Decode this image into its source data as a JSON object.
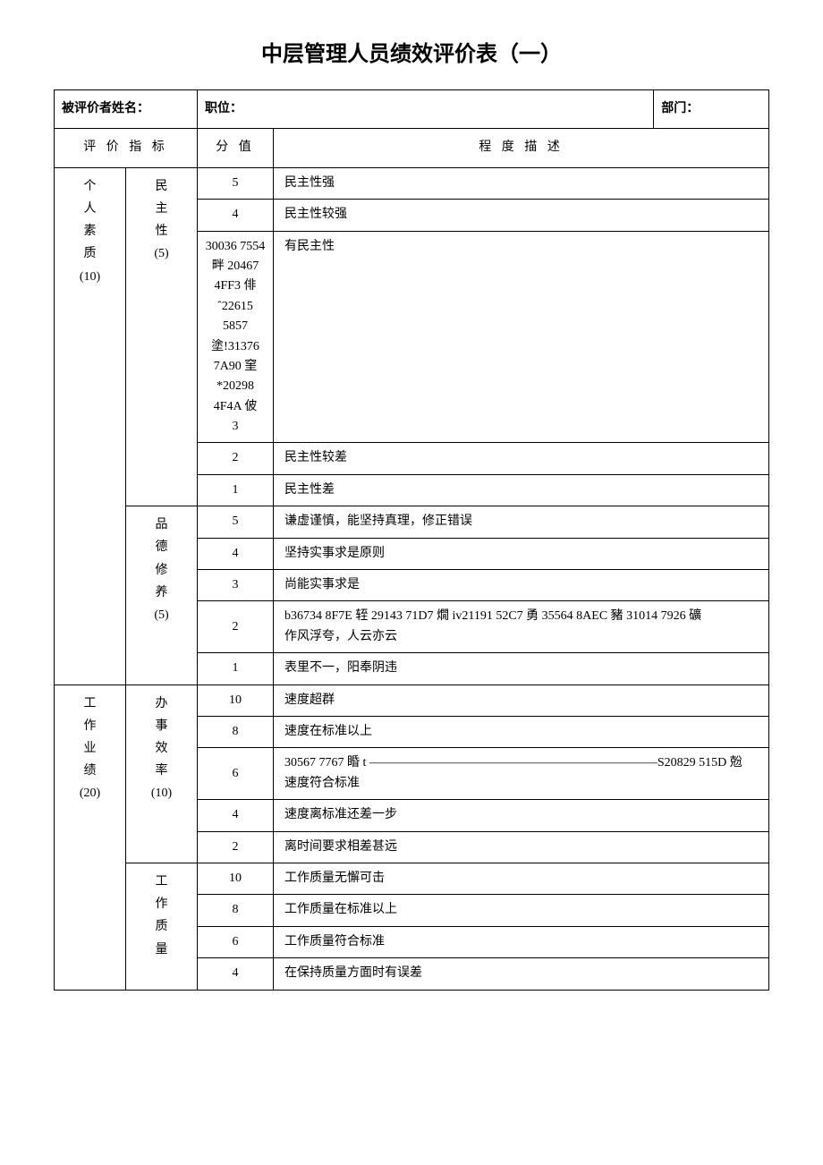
{
  "title": "中层管理人员绩效评价表（一）",
  "labels": {
    "name": "被评价者姓名：",
    "position": "职位：",
    "department": "部门：",
    "indicator": "评 价 指 标",
    "score": "分 值",
    "description": "程 度 描 述"
  },
  "sections": [
    {
      "main": "个<br>人<br>素<br>质<br>(10)",
      "groups": [
        {
          "sub": "民<br>主<br>性<br>(5)",
          "rows": [
            {
              "score": "5",
              "desc": "民主性强"
            },
            {
              "score": "4",
              "desc": "民主性较强"
            },
            {
              "score": "30036 7554 畔 20467 4FF3 俳 ˆ22615 5857 塗!31376 7A90 窐 *20298 4F4A 佊<br>3",
              "desc": "有民主性"
            },
            {
              "score": "2",
              "desc": "民主性较差"
            },
            {
              "score": "1",
              "desc": "民主性差"
            }
          ]
        },
        {
          "sub": "品<br>德<br>修<br>养<br>(5)",
          "rows": [
            {
              "score": "5",
              "desc": "谦虚谨慎，能坚持真理，修正错误"
            },
            {
              "score": "4",
              "desc": "坚持实事求是原则"
            },
            {
              "score": "3",
              "desc": "尚能实事求是"
            },
            {
              "score": "2",
              "desc": "b36734 8F7E 轾 29143 71D7 燗 iv21191 52C7 勇 35564 8AEC 豬 31014 7926 礦<br>作风浮夸，人云亦云"
            },
            {
              "score": "1",
              "desc": "表里不一，阳奉阴违"
            }
          ]
        }
      ]
    },
    {
      "main": "工<br>作<br>业<br>绩<br>(20)",
      "groups": [
        {
          "sub": "办<br>事<br>效<br>率<br>(10)",
          "rows": [
            {
              "score": "10",
              "desc": "速度超群"
            },
            {
              "score": "8",
              "desc": "速度在标准以上"
            },
            {
              "score": "6",
              "desc": "30567 7767 睧 t ———————————————————————S20829 515D 兝<br>速度符合标准"
            },
            {
              "score": "4",
              "desc": "速度离标准还差一步"
            },
            {
              "score": "2",
              "desc": "离时间要求相差甚远"
            }
          ]
        },
        {
          "sub": "工<br>作<br>质<br>量",
          "rows": [
            {
              "score": "10",
              "desc": "工作质量无懈可击"
            },
            {
              "score": "8",
              "desc": "工作质量在标准以上"
            },
            {
              "score": "6",
              "desc": "工作质量符合标准"
            },
            {
              "score": "4",
              "desc": "在保持质量方面时有误差"
            }
          ]
        }
      ]
    }
  ]
}
